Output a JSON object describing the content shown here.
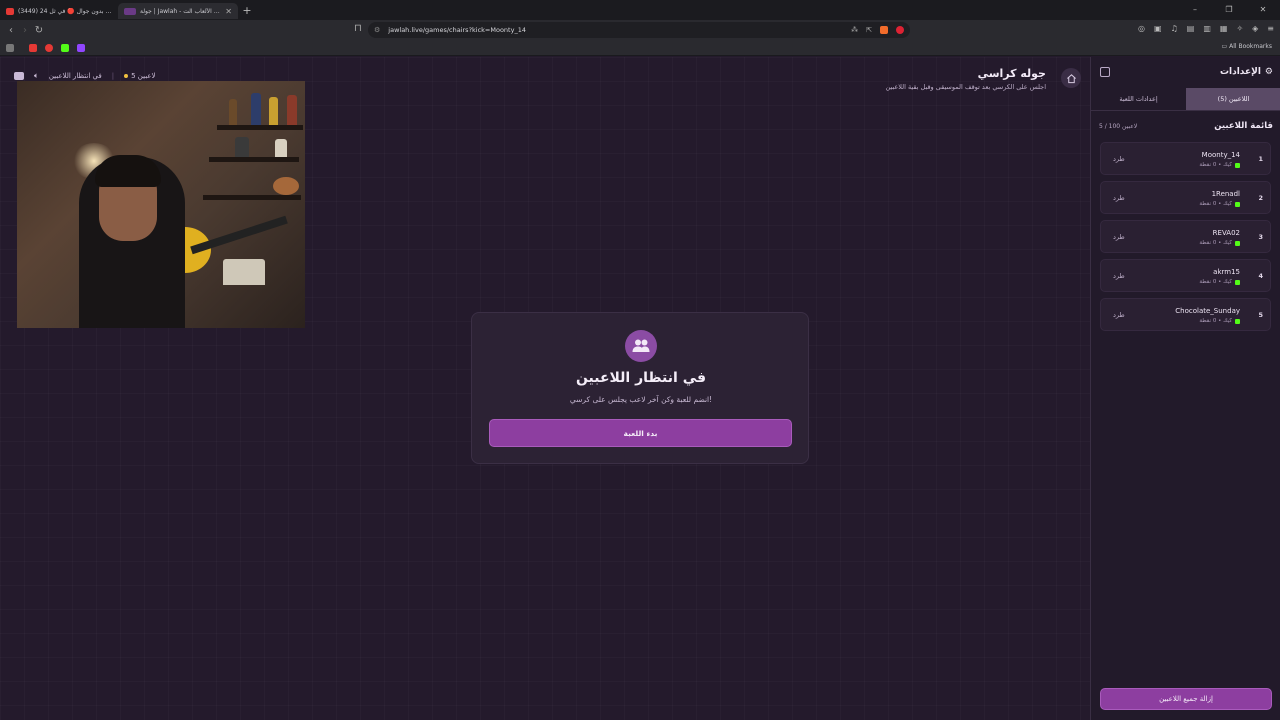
{
  "browser": {
    "tabs": [
      {
        "title": "(3449) 24 ساعه بدون جوال 🔴 في ثل..."
      },
      {
        "title": "جولة | Jawlah - منصة الألعاب الت..."
      }
    ],
    "url": "jawlah.live/games/chairs?kick=Moonty_14",
    "bookmarks_label": "All Bookmarks"
  },
  "page": {
    "status": {
      "players_text": "5 لاعبين",
      "state_text": "في انتظار اللاعبين"
    },
    "header": {
      "title": "جوله كراسي",
      "subtitle": "اجلس على الكرسي بعد توقف الموسيقى وقبل بقية اللاعبين"
    },
    "card": {
      "title": "في انتظار اللاعبين",
      "subtitle": "انضم للعبة وكن آخر لاعب يجلس على كرسي!",
      "start_label": "بدء اللعبة"
    }
  },
  "panel": {
    "title": "الإعدادات",
    "tabs": [
      {
        "label": "اللاعبين (5)",
        "active": true
      },
      {
        "label": "إعدادات اللعبة",
        "active": false
      }
    ],
    "list_title": "قائمة اللاعبين",
    "count": "5 / 100 لاعبين",
    "players": [
      {
        "rank": "1",
        "name": "Moonty_14",
        "meta": "كيك • 0 نقطة",
        "kick": "طرد"
      },
      {
        "rank": "2",
        "name": "1Renadl",
        "meta": "كيك • 0 نقطة",
        "kick": "طرد"
      },
      {
        "rank": "3",
        "name": "REVA02",
        "meta": "كيك • 0 نقطة",
        "kick": "طرد"
      },
      {
        "rank": "4",
        "name": "akrm15",
        "meta": "كيك • 0 نقطة",
        "kick": "طرد"
      },
      {
        "rank": "5",
        "name": "Chocolate_Sunday",
        "meta": "كيك • 0 نقطة",
        "kick": "طرد"
      }
    ],
    "remove_all": "إزالة جميع اللاعبين"
  },
  "colors": {
    "accent": "#8d3ea0",
    "background": "#241a2c",
    "kick_green": "#53fc18"
  }
}
